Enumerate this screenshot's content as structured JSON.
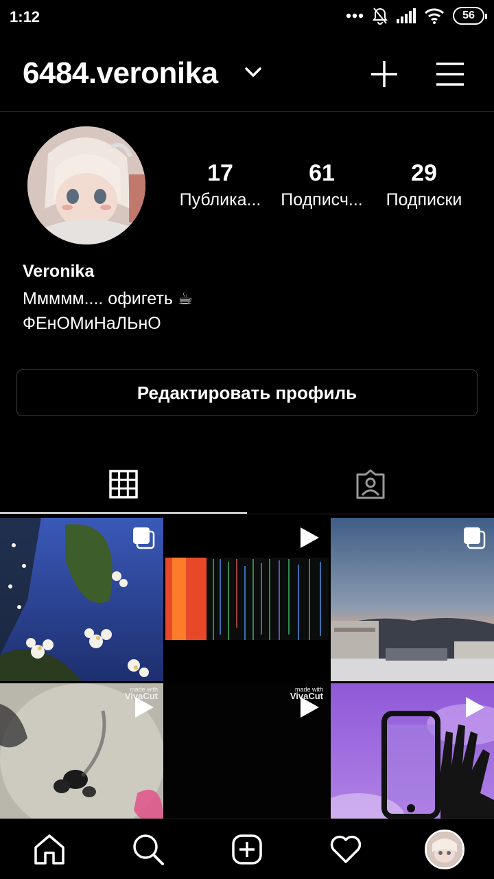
{
  "status_bar": {
    "time": "1:12",
    "battery": "56"
  },
  "header": {
    "username": "6484.veronika"
  },
  "profile": {
    "stats": [
      {
        "value": "17",
        "label": "Публика..."
      },
      {
        "value": "61",
        "label": "Подписч..."
      },
      {
        "value": "29",
        "label": "Подписки"
      }
    ],
    "name": "Veronika",
    "bio_line1": "Ммммм.... офигеть ☕",
    "bio_line2": "ФЕнОМиНаЛЬнО",
    "edit_button": "Редактировать профиль"
  },
  "grid": {
    "watermark_small": "made with",
    "watermark_big": "VivaCut",
    "posts": [
      {
        "type": "carousel",
        "theme": "white blossoms on blue sky"
      },
      {
        "type": "video",
        "theme": "glitch noise on black"
      },
      {
        "type": "carousel",
        "theme": "dusk sky over buildings"
      },
      {
        "type": "video",
        "theme": "blurred flowers"
      },
      {
        "type": "video",
        "theme": "dark frame"
      },
      {
        "type": "video",
        "theme": "phone and hand on purple sky"
      }
    ]
  },
  "colors": {
    "background": "#000000",
    "divider": "#262626",
    "button_border": "#3a3a3a"
  }
}
